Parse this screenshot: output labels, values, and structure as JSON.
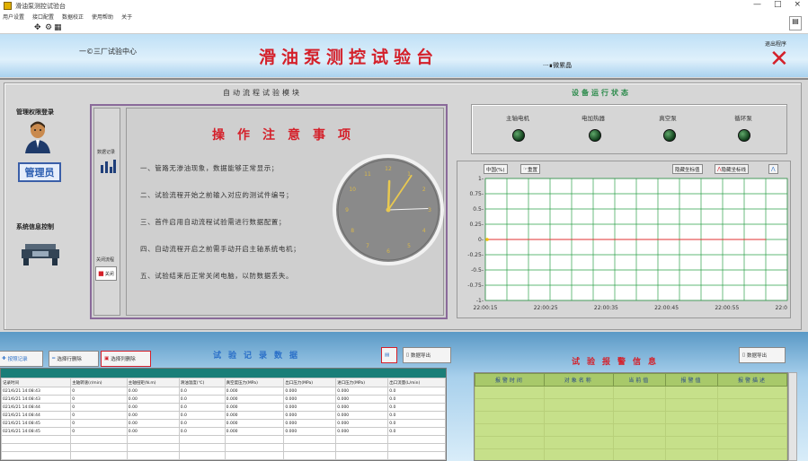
{
  "window": {
    "title": "滑油泵测控试验台",
    "min": "—",
    "max": "□",
    "close": "×"
  },
  "menu": [
    "用户设置",
    "接口配置",
    "数据校正",
    "使用帮助",
    "关于"
  ],
  "toolbar": {
    "icons": [
      "arrow-icon",
      "gear-icon",
      "grid-icon"
    ]
  },
  "header": {
    "center_name": "一©三厂试验中心",
    "main_title": "滑油泵测控试验台",
    "lab_logo": "···∎微累晶",
    "exit_label": "退出程序"
  },
  "left": {
    "permission_title": "管理权限登录",
    "user_label": "管理员",
    "system_title": "系统信息控制"
  },
  "auto_module": {
    "title": "自动流程试验模块",
    "data_record_label": "数据记录",
    "close_label": "关闭流程",
    "close_btn": "关闭",
    "notice_title": "操作注意事项",
    "notices": [
      "一、管路无渗油现象，数据能够正常显示；",
      "二、试验流程开始之前输入对应的测试件编号；",
      "三、首件启用自动流程试验需进行数据配置；",
      "四、自动流程开启之前需手动开启主轴系统电机；",
      "五、试验结束后正常关闭电脑，以防数据丢失。"
    ],
    "clock": {
      "hour": 12,
      "minute": 4,
      "second": 8,
      "numerals": [
        "12",
        "1",
        "2",
        "3",
        "4",
        "5",
        "6",
        "7",
        "8",
        "9",
        "10",
        "11"
      ]
    }
  },
  "equipment": {
    "title": "设备运行状态",
    "items": [
      {
        "label": "主轴电机",
        "on": false
      },
      {
        "label": "电加热器",
        "on": false
      },
      {
        "label": "真空泵",
        "on": false
      },
      {
        "label": "循环泵",
        "on": false
      }
    ]
  },
  "chart_controls": {
    "left_a": "中国(%)",
    "left_b": "重置",
    "right_a": "隐藏坐标值",
    "right_b": "隐藏坐标线"
  },
  "chart_data": {
    "type": "line",
    "x": [
      "22:00:15",
      "22:00:25",
      "22:00:35",
      "22:00:45",
      "22:00:55",
      "22:0"
    ],
    "ylim": [
      -1,
      1
    ],
    "yticks": [
      "1-",
      "0.75-",
      "0.5-",
      "0.25-",
      "0-",
      "-0.25-",
      "-0.5-",
      "-0.75-",
      "-1-"
    ],
    "series": [
      {
        "values": [
          0,
          0,
          0,
          0,
          0,
          0
        ]
      }
    ],
    "grid": true,
    "colors": {
      "line": "#e03030",
      "grid": "#2ea04a",
      "marker": "#f0c000"
    }
  },
  "records": {
    "title": "试验记录数据",
    "buttons": {
      "add": "按照记录",
      "select": "选择行删除",
      "delete_all": "选择列删除",
      "export": "数据导出"
    },
    "columns": [
      "记录时间",
      "主轴转速(r/min)",
      "主轴扭矩(N.m)",
      "滑油温度(℃)",
      "真空度压力(MPa)",
      "出口压力(MPa)",
      "进口压力(MPa)",
      "出口流量(L/min)"
    ],
    "rows": [
      [
        "021/6/21 14:08:43",
        "0",
        "0.00",
        "0.0",
        "0.000",
        "0.000",
        "0.000",
        "0.0"
      ],
      [
        "021/6/21 14:08:43",
        "0",
        "0.00",
        "0.0",
        "0.000",
        "0.000",
        "0.000",
        "0.0"
      ],
      [
        "021/6/21 14:08:44",
        "0",
        "0.00",
        "0.0",
        "0.000",
        "0.000",
        "0.000",
        "0.0"
      ],
      [
        "021/6/21 14:08:44",
        "0",
        "0.00",
        "0.0",
        "0.000",
        "0.000",
        "0.000",
        "0.0"
      ],
      [
        "021/6/21 14:08:45",
        "0",
        "0.00",
        "0.0",
        "0.000",
        "0.000",
        "0.000",
        "0.0"
      ],
      [
        "021/6/21 14:08:45",
        "0",
        "0.00",
        "0.0",
        "0.000",
        "0.000",
        "0.000",
        "0.0"
      ]
    ]
  },
  "alarms": {
    "title": "试验报警信息",
    "export": "数据导出",
    "columns": [
      "报警时间",
      "对象名称",
      "当前值",
      "报警值",
      "报警描述"
    ]
  },
  "colors": {
    "accent_red": "#d4202a",
    "accent_blue": "#2a6fc8",
    "led_off": "#1c5a2a",
    "table_header": "#1a7e78"
  }
}
